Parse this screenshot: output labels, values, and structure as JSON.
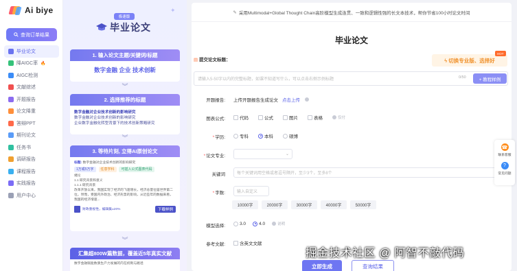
{
  "app": {
    "logo": "Ai biye",
    "logo_colors": [
      "#ff5b6a",
      "#ffb13b",
      "#4ea0ff"
    ]
  },
  "sidebar": {
    "order_button": "查询订单结果",
    "items": [
      {
        "label": "毕业论文",
        "active": true,
        "color": "#6a73f0"
      },
      {
        "label": "降AIGC率",
        "color": "#35c27a",
        "badge": "fire-icon"
      },
      {
        "label": "AIGC检测",
        "color": "#3b8cf7"
      },
      {
        "label": "文献综述",
        "color": "#f05050"
      },
      {
        "label": "开题报告",
        "color": "#8c6cf0"
      },
      {
        "label": "论文降重",
        "color": "#ff8f3a"
      },
      {
        "label": "答辩PPT",
        "color": "#ff6a4a"
      },
      {
        "label": "期刊论文",
        "color": "#5a9cf8"
      },
      {
        "label": "任务书",
        "color": "#30c0a0"
      },
      {
        "label": "调研报告",
        "color": "#f0a030"
      },
      {
        "label": "课程报告",
        "color": "#3ab0f0"
      },
      {
        "label": "实践报告",
        "color": "#7b6cf6"
      },
      {
        "label": "用户中心",
        "color": "#9aa0b5"
      }
    ]
  },
  "promo": {
    "badge": "极速版",
    "title": "毕业论文",
    "step1": {
      "title": "1. 输入论文主题/关键词/标题",
      "keywords": "数字金融 企业 技术创新"
    },
    "step2": {
      "title": "2. 选择推荐的标题",
      "titles": [
        "数字金融对企业技术创新的影响研究",
        "数字金融对企业技术创新的影响研究",
        "企业数字金融化转型背景下的技术创新策略研究"
      ]
    },
    "step3": {
      "title": "3. 等待片刻, 立得AI原创论文",
      "paper_title_label": "标题:",
      "paper_title": "数字金融对企业技术创新的影响研究",
      "tags": [
        "1万或5万字",
        "任意学科",
        "可插入公式图表代码"
      ],
      "outline_label": "绪论",
      "outline": [
        "1.1 研究背景和意义",
        "1.1.1 研究背景"
      ],
      "excerpt": "改革开放以来，我国实现了经济的飞速增长，经济总量位居世界第二位。然而，受国内外政治、经济形势的影响，从近些年的数据来看，我国的经济增速...",
      "footer_note": "财政重视性，编辑集±20%",
      "download": "下载样例"
    },
    "step4": {
      "title": "汇集超800W篇数据，覆盖近5年真实文献",
      "subtitle": "数字金融赋能数质生产力发展的内在机制与路径"
    }
  },
  "main": {
    "banner": "采用Multimodal+Global Thought Chain高阶模型生成连贯、一致和逻辑性强的长文本技术，帮你节省100小时论文时间",
    "page_title": "毕业论文",
    "section_label": "提交论文标题：",
    "pro_button": "切换专业版、选择好",
    "pro_tag": "HOT",
    "title_placeholder": "请输入5-50字以内的完整标题，如课不知道写什么，可以点击右侧示例标题",
    "counter": "0/50",
    "example_button": "+ 教程样例",
    "proposal": {
      "label": "开题报告:",
      "text": "上传开题报告生成论文",
      "link": "点击上传"
    },
    "figures": {
      "label": "图表公式:",
      "options": [
        "代码",
        "公式",
        "图片",
        "表格"
      ],
      "note": "仅付"
    },
    "degree": {
      "label": "学历:",
      "options": [
        "专科",
        "本科",
        "硕博"
      ],
      "selected": "本科"
    },
    "major": {
      "label": "论文专业:",
      "placeholder": ""
    },
    "keywords": {
      "label": "关键词",
      "placeholder": "每个关键词用空格或者逗号隔开，至少3个，至多8个"
    },
    "wordcount": {
      "label": "字数:",
      "placeholder": "输入自定义",
      "options": [
        "10000字",
        "20000字",
        "30000字",
        "40000字",
        "50000字"
      ]
    },
    "model": {
      "label": "模型选择:",
      "options": [
        "3.0",
        "4.0"
      ],
      "selected": "4.0",
      "note": "说明"
    },
    "references": {
      "label": "参考文献:",
      "option": "含英文文献"
    },
    "buttons": {
      "generate": "立即生成",
      "check": "查询结果"
    }
  },
  "float_rail": [
    {
      "label": "联系客服",
      "icon": "headset-icon",
      "color": "#ff8f1f"
    },
    {
      "label": "常见问题",
      "icon": "question-icon",
      "color": "#3b8cf7"
    }
  ],
  "watermark": "掘金技术社区 @ 阿智不敲代码"
}
